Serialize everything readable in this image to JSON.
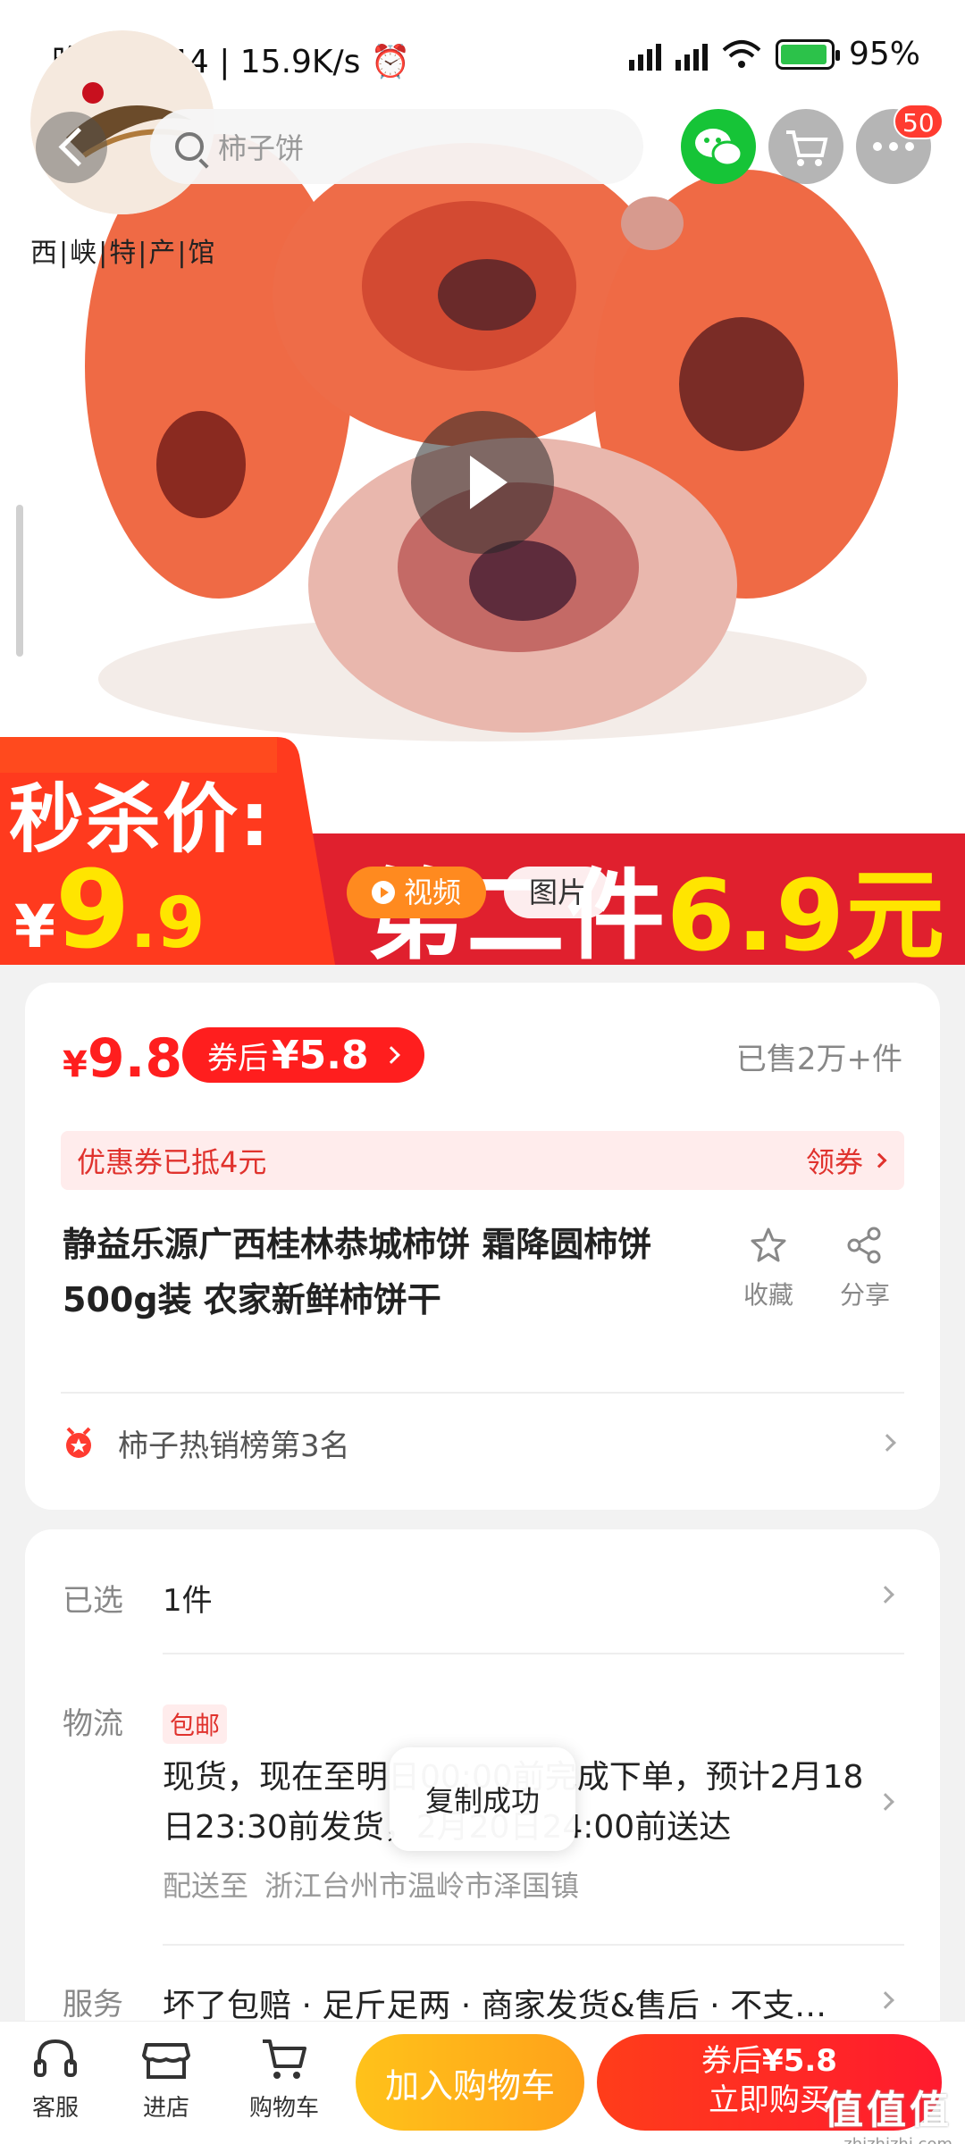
{
  "status_bar": {
    "time": "晚上10:44",
    "net_speed": "15.9K/s",
    "battery": "95%"
  },
  "top_nav": {
    "shop_name": "西|峡|特|产|馆",
    "search_placeholder": "柿子饼",
    "more_badge": "50"
  },
  "hero": {
    "promo_left": "秒杀价:",
    "promo_price_currency": "¥",
    "promo_price_int": "9",
    "promo_price_dec": ".9",
    "promo_right_prefix": "第二件",
    "promo_right_value": "6.9元",
    "tab_video": "视频",
    "tab_photo": "图片"
  },
  "price_card": {
    "currency": "¥",
    "price": "9.8",
    "coupon_label": "券后",
    "coupon_price": "¥5.8",
    "sold": "已售2万+件",
    "discount_text": "优惠券已抵4元",
    "claim_text": "领券",
    "title": "静益乐源广西桂林恭城柿饼 霜降圆柿饼500g装 农家新鲜柿饼干",
    "fav_label": "收藏",
    "share_label": "分享",
    "rank_text": "柿子热销榜第3名"
  },
  "selection_card": {
    "selected_label": "已选",
    "selected_value": "1件",
    "logistics_label": "物流",
    "shipping_tag": "包邮",
    "shipping_text": "现货，现在至明日00:00前完成下单，预计2月18日23:30前发货，2月20日24:00前送达",
    "ship_to_label": "配送至",
    "ship_to_addr": "浙江台州市温岭市泽国镇",
    "service_label": "服务",
    "service_text": "坏了包赔 · 足斤足两 · 商家发货&售后 · 不支…"
  },
  "toast": "复制成功",
  "bottom_bar": {
    "service": "客服",
    "shop": "进店",
    "cart": "购物车",
    "add_to_cart": "加入购物车",
    "buy_line1_label": "券后",
    "buy_line1_price": "¥5.8",
    "buy_line2": "立即购买"
  },
  "watermark": {
    "big": "值值值",
    "small": "zhizhizhi.com"
  },
  "colors": {
    "accent_red": "#ff1e1e",
    "accent_orange": "#ffa21a",
    "wechat_green": "#16c437"
  }
}
